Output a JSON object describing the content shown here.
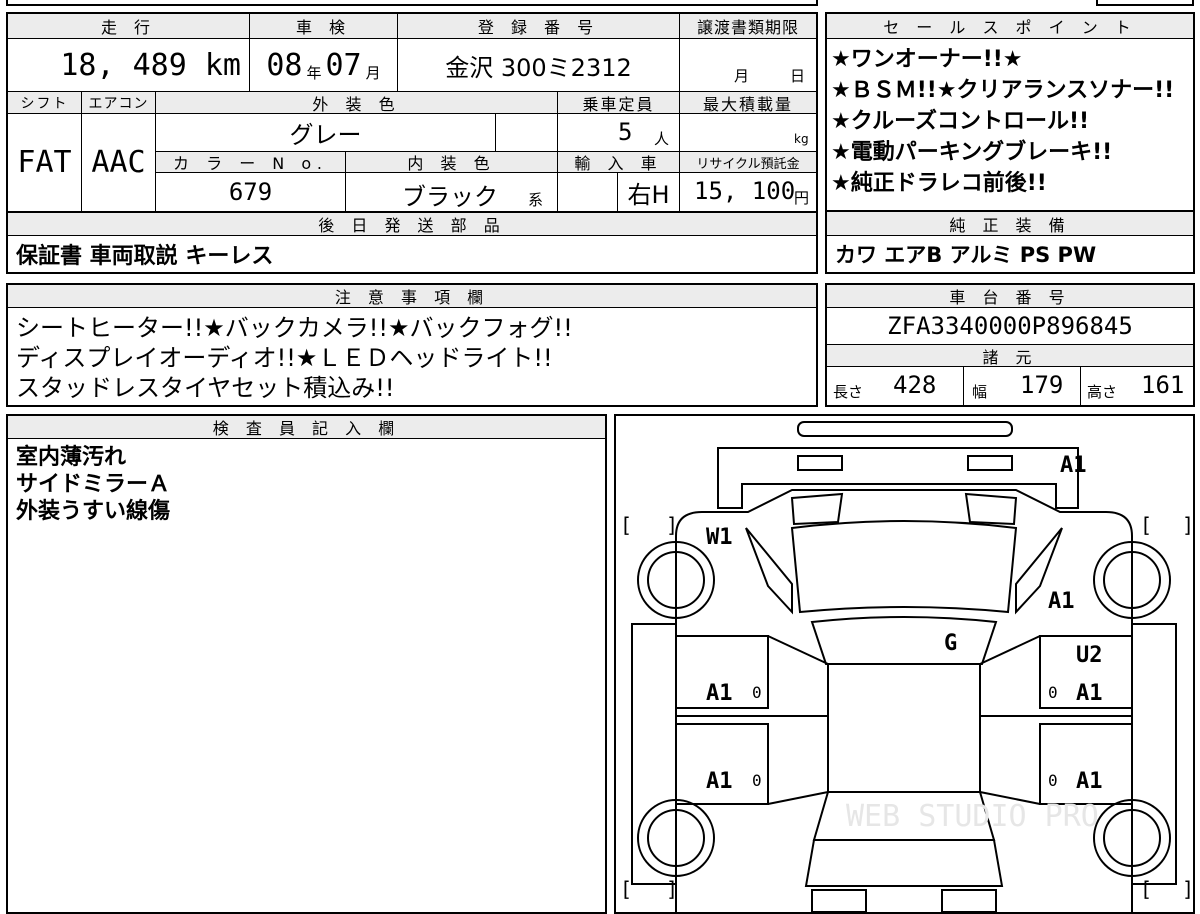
{
  "main_table": {
    "mileage_header": "走 行",
    "mileage_value": "18, 489 km",
    "inspection_header": "車 検",
    "inspection_year": "08",
    "inspection_year_unit": "年",
    "inspection_month": "07",
    "inspection_month_unit": "月",
    "registration_header": "登 録 番 号",
    "registration_value": "金沢 300ミ2312",
    "transfer_header": "譲渡書類期限",
    "transfer_month_unit": "月",
    "transfer_day_unit": "日",
    "shift_header": "シフト",
    "shift_value": "FAT",
    "aircon_header": "エアコン",
    "aircon_value": "AAC",
    "exterior_color_header": "外 装 色",
    "exterior_color_value": "グレー",
    "capacity_header": "乗車定員",
    "capacity_value": "5",
    "capacity_unit": "人",
    "max_load_header": "最大積載量",
    "max_load_unit": "kg",
    "color_no_header": "カ ラ ー N o.",
    "color_no_value": "679",
    "interior_color_header": "内 装 色",
    "interior_color_value": "ブラック",
    "interior_color_suffix": "系",
    "import_header": "輸 入 車",
    "import_value": "右H",
    "recycle_header": "リサイクル預託金",
    "recycle_value": "15, 100",
    "recycle_unit": "円",
    "later_parts_header": "後 日 発 送 部 品",
    "later_parts_value": "保証書 車両取説 キーレス"
  },
  "sales_points": {
    "header": "セ ー ル ス ポ イ ン ト",
    "lines": [
      "★ワンオーナー!!★",
      "★ＢＳＭ!!★クリアランスソナー!!",
      "★クルーズコントロール!!",
      "★電動パーキングブレーキ!!",
      "★純正ドラレコ前後!!"
    ]
  },
  "factory_equipment": {
    "header": "純 正 装 備",
    "value": "カワ エアB アルミ PS PW"
  },
  "notes": {
    "header": "注 意 事 項 欄",
    "lines": [
      "シートヒーター!!★バックカメラ!!★バックフォグ!!",
      "ディスプレイオーディオ!!★ＬＥＤヘッドライト!!",
      "スタッドレスタイヤセット積込み!!"
    ]
  },
  "chassis": {
    "header": "車 台 番 号",
    "value": "ZFA3340000P896845"
  },
  "specs": {
    "header": "諸 元",
    "length_label": "長さ",
    "length_value": "428",
    "width_label": "幅",
    "width_value": "179",
    "height_label": "高さ",
    "height_value": "161"
  },
  "inspector": {
    "header": "検 査 員 記 入 欄",
    "lines": [
      "室内薄汚れ",
      "サイドミラーＡ",
      "外装うすい線傷"
    ]
  },
  "damage_map": {
    "marks": [
      "A1",
      "W1",
      "A1",
      "G",
      "U2",
      "A1",
      "A1",
      "A1",
      "A1"
    ],
    "zeros": [
      "0",
      "0",
      "0",
      "0"
    ],
    "brackets": [
      "[",
      "]",
      "[",
      "]",
      "[",
      "]",
      "[",
      "]"
    ],
    "watermark": "WEB STUDIO PRO"
  },
  "colors": {
    "border": "#000000",
    "header_bg": "#ececec",
    "background": "#ffffff"
  }
}
